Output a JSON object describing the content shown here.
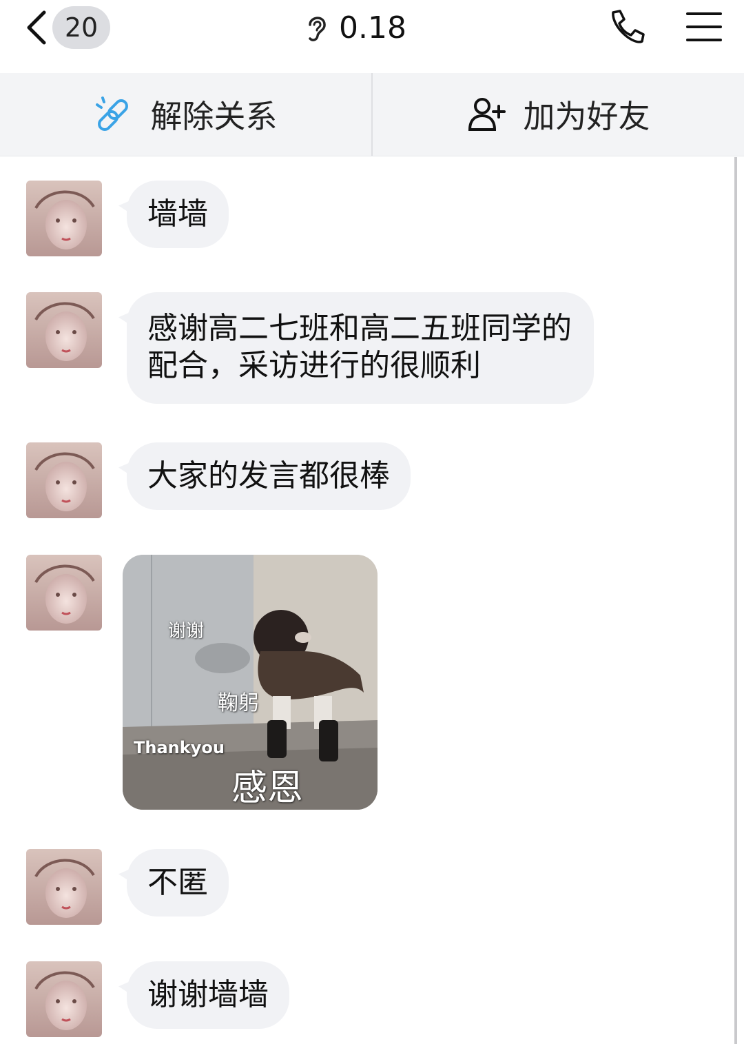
{
  "header": {
    "back_badge": "20",
    "title": "0.18",
    "icons": [
      "back-chevron-icon",
      "ear-icon",
      "phone-icon",
      "menu-icon"
    ]
  },
  "actions": {
    "unbind_label": "解除关系",
    "add_friend_label": "加为好友"
  },
  "messages": [
    {
      "type": "text",
      "text": "墙墙"
    },
    {
      "type": "text",
      "lines": [
        "感谢高二七班和高二五班同学的",
        "配合，采访进行的很顺利"
      ]
    },
    {
      "type": "text",
      "text": "大家的发言都很棒"
    },
    {
      "type": "sticker",
      "captions": {
        "top": "谢谢",
        "middle": "鞠躬",
        "english": "Thankyou",
        "bottom": "感恩"
      }
    },
    {
      "type": "text",
      "text": "不匿"
    },
    {
      "type": "text",
      "text": "谢谢墙墙"
    }
  ],
  "colors": {
    "accent_link": "#3aa3e6",
    "bubble_bg": "#f1f2f5",
    "actionbar_bg": "#f3f4f6"
  }
}
